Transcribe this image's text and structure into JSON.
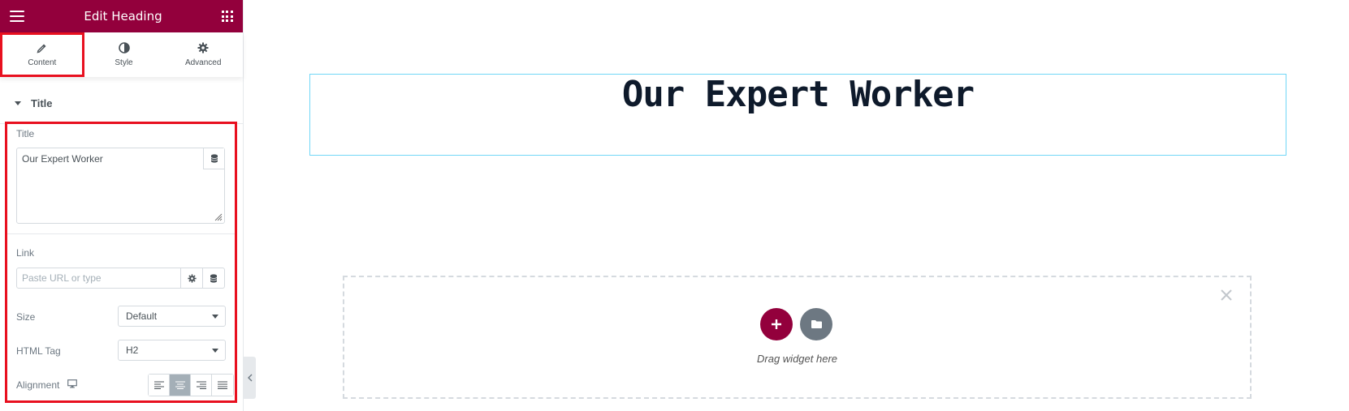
{
  "header": {
    "title": "Edit Heading"
  },
  "tabs": [
    {
      "label": "Content",
      "icon": "pencil-icon"
    },
    {
      "label": "Style",
      "icon": "contrast-icon"
    },
    {
      "label": "Advanced",
      "icon": "gear-icon"
    }
  ],
  "section": {
    "title": "Title"
  },
  "controls": {
    "title_label": "Title",
    "title_value": "Our Expert Worker",
    "link_label": "Link",
    "link_placeholder": "Paste URL or type",
    "size_label": "Size",
    "size_value": "Default",
    "html_tag_label": "HTML Tag",
    "html_tag_value": "H2",
    "alignment_label": "Alignment",
    "alignment_selected": "center"
  },
  "preview": {
    "heading": "Our Expert Worker",
    "drag_text": "Drag widget here"
  },
  "colors": {
    "brand": "#93003c",
    "highlight": "#e8101f",
    "selection_border": "#71d7f7"
  }
}
